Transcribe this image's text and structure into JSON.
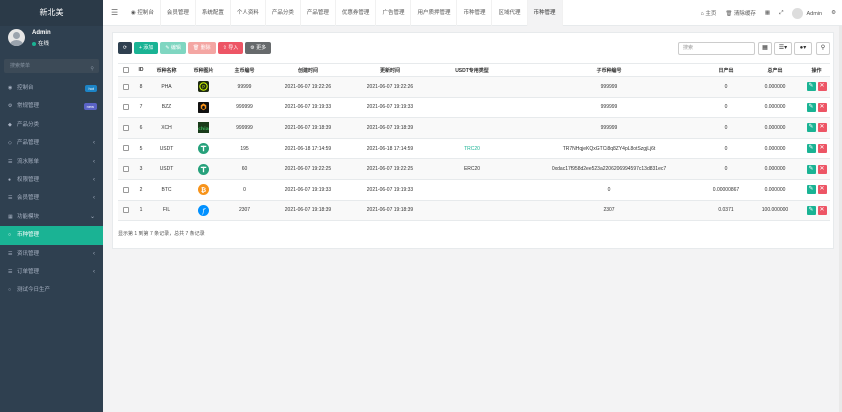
{
  "app": {
    "title": "新北美"
  },
  "user": {
    "name": "Admin",
    "status": "在线"
  },
  "sidebar": {
    "search_placeholder": "搜索菜单",
    "items": [
      {
        "label": "控制台",
        "badge": "hot"
      },
      {
        "label": "常规管理",
        "badge": "new"
      },
      {
        "label": "产品分类"
      },
      {
        "label": "产品管理"
      },
      {
        "label": "流水账单"
      },
      {
        "label": "权限管理"
      },
      {
        "label": "会员管理"
      },
      {
        "label": "功能模块"
      },
      {
        "label": "币种管理"
      },
      {
        "label": "资讯管理"
      },
      {
        "label": "订单管理"
      },
      {
        "label": "测试今日生产"
      }
    ]
  },
  "topbar": {
    "tabs": [
      "控制台",
      "会员管理",
      "系统配置",
      "个人资料",
      "产品分类",
      "产品管理",
      "优惠券管理",
      "广告管理",
      "用户质押管理",
      "币种管理",
      "区域代理",
      "币种管理"
    ],
    "home": "主页",
    "clear_cache": "清除缓存",
    "admin": "Admin"
  },
  "toolbar": {
    "add": "+ 添加",
    "edit": "✎ 编辑",
    "delete": "🗑 删除",
    "import": "导入",
    "more": "更多"
  },
  "search": {
    "placeholder": "搜索"
  },
  "table": {
    "headers": [
      "ID",
      "币种名称",
      "币种图片",
      "主币编号",
      "创建时间",
      "更新时间",
      "USDT专用类型",
      "子币种编号",
      "日产出",
      "总产出",
      "操作"
    ],
    "rows": [
      {
        "id": "8",
        "name": "PHA",
        "icon": "pha",
        "main_no": "99999",
        "created": "2021-06-07 19:22:26",
        "updated": "2021-06-07 19:22:26",
        "usdt_type": "",
        "sub_no": "999999",
        "daily": "0",
        "total": "0.000000"
      },
      {
        "id": "7",
        "name": "BZZ",
        "icon": "bzz",
        "main_no": "999999",
        "created": "2021-06-07 19:19:33",
        "updated": "2021-06-07 19:19:33",
        "usdt_type": "",
        "sub_no": "999999",
        "daily": "0",
        "total": "0.000000"
      },
      {
        "id": "6",
        "name": "XCH",
        "icon": "chia",
        "main_no": "999999",
        "created": "2021-06-07 19:18:39",
        "updated": "2021-06-07 19:18:39",
        "usdt_type": "",
        "sub_no": "999999",
        "daily": "0",
        "total": "0.000000"
      },
      {
        "id": "5",
        "name": "USDT",
        "icon": "usdt",
        "main_no": "195",
        "created": "2021-06-18 17:14:59",
        "updated": "2021-06-18 17:14:59",
        "usdt_type": "TRC20",
        "sub_no": "TR7NHqjeKQxGTCi8q8ZY4pL8otSzgjLj6t",
        "daily": "0",
        "total": "0.000000"
      },
      {
        "id": "3",
        "name": "USDT",
        "icon": "usdt",
        "main_no": "60",
        "created": "2021-06-07 19:22:25",
        "updated": "2021-06-07 19:22:25",
        "usdt_type": "ERC20",
        "sub_no": "0xdac17f958d2ee523a2206206994597c13d831ec7",
        "daily": "0",
        "total": "0.000000"
      },
      {
        "id": "2",
        "name": "BTC",
        "icon": "btc",
        "main_no": "0",
        "created": "2021-06-07 19:19:33",
        "updated": "2021-06-07 19:19:33",
        "usdt_type": "",
        "sub_no": "0",
        "daily": "0.00000867",
        "total": "0.000000"
      },
      {
        "id": "1",
        "name": "FIL",
        "icon": "fil",
        "main_no": "2307",
        "created": "2021-06-07 19:18:39",
        "updated": "2021-06-07 19:18:39",
        "usdt_type": "",
        "sub_no": "2307",
        "daily": "0.0371",
        "total": "100.000000"
      }
    ]
  },
  "pager": {
    "summary": "显示第 1 到第 7 条记录，总共 7 条记录"
  },
  "colors": {
    "sidebar_bg": "#2f4050",
    "accent": "#1ab394",
    "danger": "#ed5565"
  }
}
